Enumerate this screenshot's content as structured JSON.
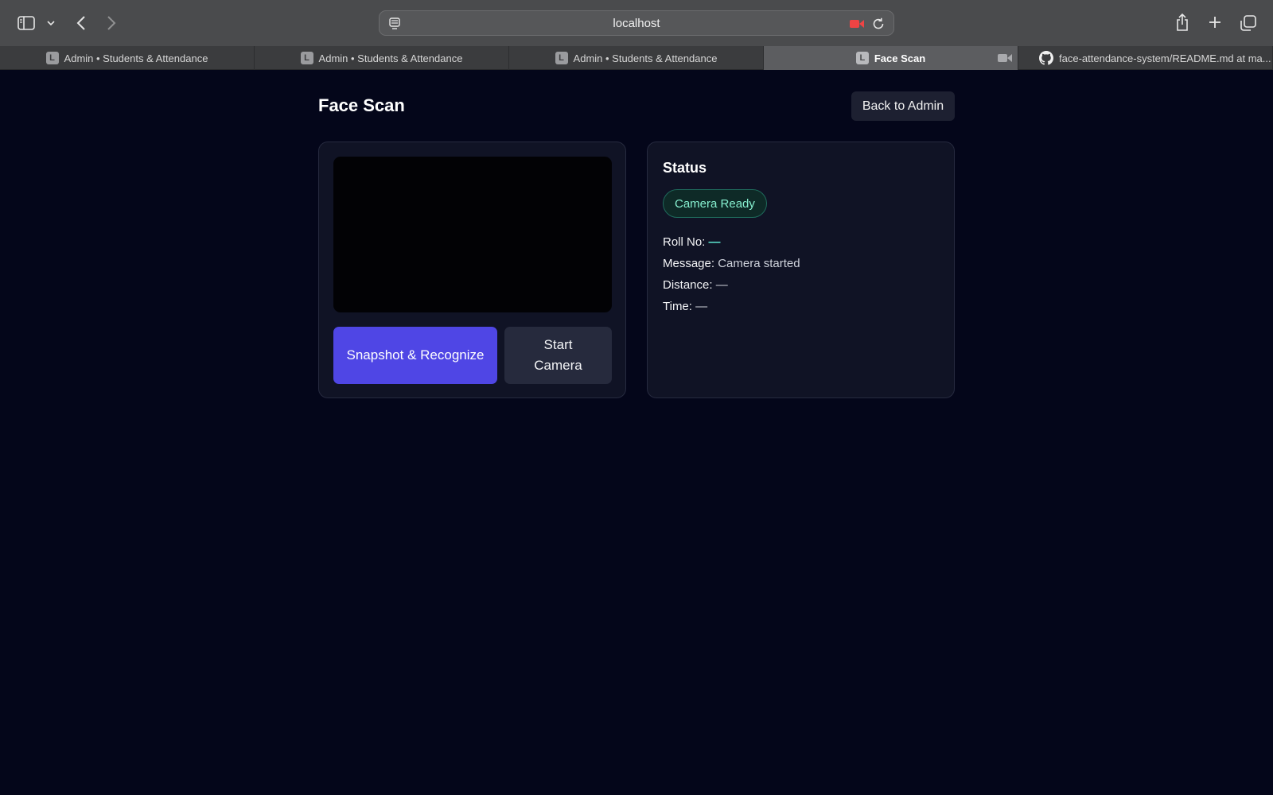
{
  "browser": {
    "url": "localhost",
    "tabs": [
      {
        "favicon": "L",
        "label": "Admin • Students & Attendance",
        "active": false
      },
      {
        "favicon": "L",
        "label": "Admin • Students & Attendance",
        "active": false
      },
      {
        "favicon": "L",
        "label": "Admin • Students & Attendance",
        "active": false
      },
      {
        "favicon": "L",
        "label": "Face Scan",
        "active": true,
        "recording": true
      },
      {
        "favicon": "github-icon",
        "label": "face-attendance-system/README.md at ma...",
        "active": false
      }
    ],
    "icons": [
      "sidebar-icon",
      "chevron-down-icon",
      "back-arrow-icon",
      "forward-arrow-icon",
      "page-icon",
      "camera-recording-icon",
      "reload-icon",
      "share-icon",
      "plus-icon",
      "tabs-overview-icon"
    ],
    "recording_color": "#ef4444"
  },
  "page": {
    "title": "Face Scan",
    "back_button": "Back to Admin",
    "camera": {
      "snapshot_button": "Snapshot & Recognize",
      "start_button": "Start Camera",
      "accent_color": "#4f46e5"
    },
    "status": {
      "heading": "Status",
      "badge": "Camera Ready",
      "badge_color": "#86efcf",
      "rows": [
        {
          "label": "Roll No:",
          "value": "—"
        },
        {
          "label": "Message:",
          "value": "Camera started"
        },
        {
          "label": "Distance:",
          "value": "—"
        },
        {
          "label": "Time:",
          "value": "—"
        }
      ]
    }
  }
}
